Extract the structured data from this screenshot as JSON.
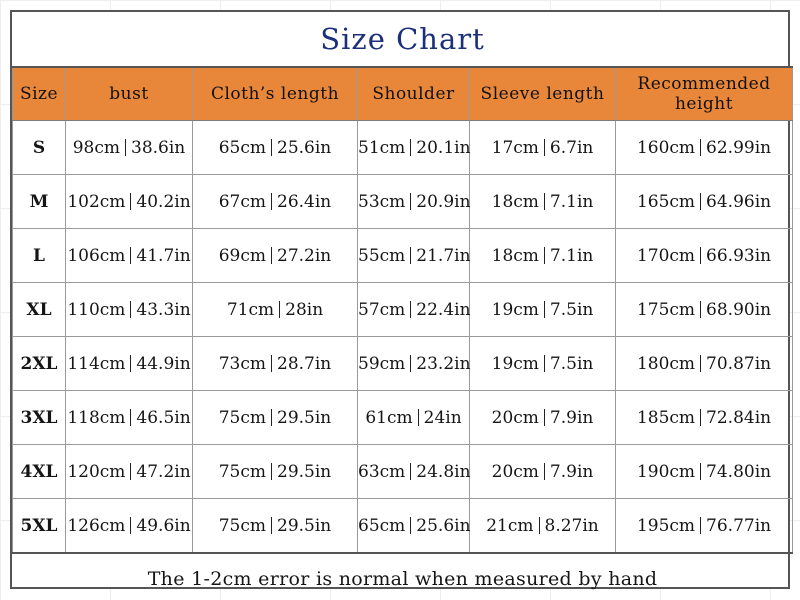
{
  "title": "Size Chart",
  "colors": {
    "header_background": "#E8873A",
    "title_text": "#1B2F7A",
    "body_text": "#151515",
    "border": "#9A9A9A",
    "outer_border": "#555555"
  },
  "table": {
    "columns": [
      {
        "key": "size",
        "label": "Size"
      },
      {
        "key": "bust",
        "label": "bust"
      },
      {
        "key": "cloth",
        "label": "Cloth’s length"
      },
      {
        "key": "should",
        "label": "Shoulder"
      },
      {
        "key": "sleeve",
        "label": "Sleeve length"
      },
      {
        "key": "height",
        "label": "Recommended height"
      }
    ],
    "rows": [
      {
        "size": "S",
        "bust_cm": "98cm",
        "bust_in": "38.6in",
        "cloth_cm": "65cm",
        "cloth_in": "25.6in",
        "should_cm": "51cm",
        "should_in": "20.1in",
        "sleeve_cm": "17cm",
        "sleeve_in": "6.7in",
        "height_cm": "160cm",
        "height_in": "62.99in"
      },
      {
        "size": "M",
        "bust_cm": "102cm",
        "bust_in": "40.2in",
        "cloth_cm": "67cm",
        "cloth_in": "26.4in",
        "should_cm": "53cm",
        "should_in": "20.9in",
        "sleeve_cm": "18cm",
        "sleeve_in": "7.1in",
        "height_cm": "165cm",
        "height_in": "64.96in"
      },
      {
        "size": "L",
        "bust_cm": "106cm",
        "bust_in": "41.7in",
        "cloth_cm": "69cm",
        "cloth_in": "27.2in",
        "should_cm": "55cm",
        "should_in": "21.7in",
        "sleeve_cm": "18cm",
        "sleeve_in": "7.1in",
        "height_cm": "170cm",
        "height_in": "66.93in"
      },
      {
        "size": "XL",
        "bust_cm": "110cm",
        "bust_in": "43.3in",
        "cloth_cm": "71cm",
        "cloth_in": "28in",
        "should_cm": "57cm",
        "should_in": "22.4in",
        "sleeve_cm": "19cm",
        "sleeve_in": "7.5in",
        "height_cm": "175cm",
        "height_in": "68.90in"
      },
      {
        "size": "2XL",
        "bust_cm": "114cm",
        "bust_in": "44.9in",
        "cloth_cm": "73cm",
        "cloth_in": "28.7in",
        "should_cm": "59cm",
        "should_in": "23.2in",
        "sleeve_cm": "19cm",
        "sleeve_in": "7.5in",
        "height_cm": "180cm",
        "height_in": "70.87in"
      },
      {
        "size": "3XL",
        "bust_cm": "118cm",
        "bust_in": "46.5in",
        "cloth_cm": "75cm",
        "cloth_in": "29.5in",
        "should_cm": "61cm",
        "should_in": "24in",
        "sleeve_cm": "20cm",
        "sleeve_in": "7.9in",
        "height_cm": "185cm",
        "height_in": "72.84in"
      },
      {
        "size": "4XL",
        "bust_cm": "120cm",
        "bust_in": "47.2in",
        "cloth_cm": "75cm",
        "cloth_in": "29.5in",
        "should_cm": "63cm",
        "should_in": "24.8in",
        "sleeve_cm": "20cm",
        "sleeve_in": "7.9in",
        "height_cm": "190cm",
        "height_in": "74.80in"
      },
      {
        "size": "5XL",
        "bust_cm": "126cm",
        "bust_in": "49.6in",
        "cloth_cm": "75cm",
        "cloth_in": "29.5in",
        "should_cm": "65cm",
        "should_in": "25.6in",
        "sleeve_cm": "21cm",
        "sleeve_in": "8.27in",
        "height_cm": "195cm",
        "height_in": "76.77in"
      }
    ]
  },
  "footnote": "The 1-2cm error is normal when measured by hand"
}
